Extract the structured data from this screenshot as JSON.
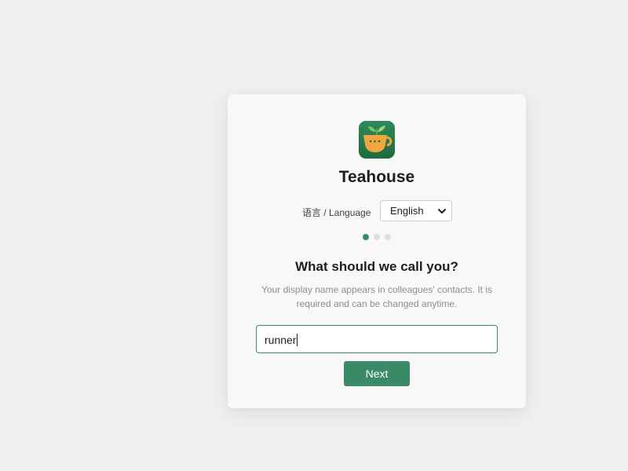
{
  "app": {
    "title": "Teahouse",
    "logo_icon": "teacup-sprout-icon"
  },
  "language": {
    "label": "语言 / Language",
    "selected": "English",
    "chevron": "▾"
  },
  "steps": {
    "total": 3,
    "current": 1
  },
  "form": {
    "question": "What should we call you?",
    "hint": "Your display name appears in colleagues' contacts. It is required and can be changed anytime.",
    "name_value": "runner",
    "next_label": "Next"
  },
  "colors": {
    "background": "#edf0ed",
    "card": "#f7f8f7",
    "accent": "#3a8a68",
    "logo": "#2a7a4c"
  }
}
